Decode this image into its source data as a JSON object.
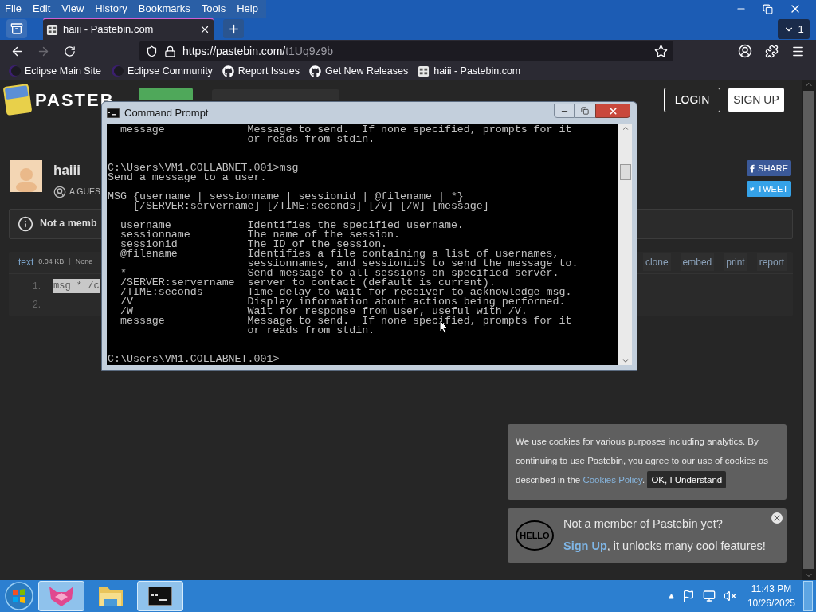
{
  "browser": {
    "menu": [
      "File",
      "Edit",
      "View",
      "History",
      "Bookmarks",
      "Tools",
      "Help"
    ],
    "tab": {
      "title": "haiii - Pastebin.com",
      "selected": true
    },
    "tab_count": "1",
    "forward_disabled": true,
    "url": {
      "host": "https://pastebin.com/",
      "path": "t1Uq9z9b"
    },
    "bookmarks": [
      {
        "label": "Eclipse Main Site",
        "kind": "eclipse"
      },
      {
        "label": "Eclipse Community",
        "kind": "eclipse"
      },
      {
        "label": "Report Issues",
        "kind": "github"
      },
      {
        "label": "Get New Releases",
        "kind": "github"
      },
      {
        "label": "haiii - Pastebin.com",
        "kind": "pastebin"
      }
    ]
  },
  "pastebin": {
    "logo_text": "PASTEB",
    "login": "LOGIN",
    "signup": "SIGN UP",
    "user": "haiii",
    "guest": "A GUES",
    "share": "SHARE",
    "tweet": "TWEET",
    "notice": "Not a memb",
    "toolbar": {
      "syntax": "text",
      "size": "0.04 KB",
      "separator": "|",
      "visibility": "None"
    },
    "actions": [
      "clone",
      "embed",
      "print",
      "report"
    ],
    "lines": [
      {
        "number": "1.",
        "code": "msg * /c",
        "highlighted": true
      },
      {
        "number": "2."
      }
    ]
  },
  "cookie_notice": {
    "text": "We use cookies for various purposes including analytics. By continuing to use Pastebin, you agree to our use of cookies as described in the ",
    "link": "Cookies Policy",
    "after": ".",
    "button": "OK, I Understand"
  },
  "signup_prompt": {
    "badge": "HELLO",
    "title": "Not a member of Pastebin yet?",
    "link": "Sign Up",
    "text": ", it unlocks many cool features!"
  },
  "cmd": {
    "title": "Command Prompt",
    "lines": [
      {
        "kind": "text",
        "text": "  message             Message to send.  If none specified, prompts for it"
      },
      {
        "kind": "text",
        "text": "                      or reads from stdin."
      },
      {
        "kind": "blank"
      },
      {
        "kind": "blank"
      },
      {
        "kind": "text",
        "text": "C:\\Users\\VM1.COLLABNET.001>msg"
      },
      {
        "kind": "text",
        "text": "Send a message to a user."
      },
      {
        "kind": "blank"
      },
      {
        "kind": "text",
        "text": "MSG {username | sessionname | sessionid | @filename | *}"
      },
      {
        "kind": "text",
        "text": "    [/SERVER:servername] [/TIME:seconds] [/V] [/W] [message]"
      },
      {
        "kind": "blank"
      },
      {
        "kind": "text",
        "text": "  username            Identifies the specified username."
      },
      {
        "kind": "text",
        "text": "  sessionname         The name of the session."
      },
      {
        "kind": "text",
        "text": "  sessionid           The ID of the session."
      },
      {
        "kind": "text",
        "text": "  @filename           Identifies a file containing a list of usernames,"
      },
      {
        "kind": "text",
        "text": "                      sessionnames, and sessionids to send the message to."
      },
      {
        "kind": "text",
        "text": "  *                   Send message to all sessions on specified server."
      },
      {
        "kind": "text",
        "text": "  /SERVER:servername  server to contact (default is current)."
      },
      {
        "kind": "text",
        "text": "  /TIME:seconds       Time delay to wait for receiver to acknowledge msg."
      },
      {
        "kind": "text",
        "text": "  /V                  Display information about actions being performed."
      },
      {
        "kind": "text",
        "text": "  /W                  Wait for response from user, useful with /V."
      },
      {
        "kind": "text",
        "text": "  message             Message to send.  If none specified, prompts for it"
      },
      {
        "kind": "text",
        "text": "                      or reads from stdin."
      },
      {
        "kind": "blank"
      },
      {
        "kind": "blank"
      },
      {
        "kind": "text",
        "text": "C:\\Users\\VM1.COLLABNET.001>"
      }
    ]
  },
  "taskbar": {
    "apps": [
      {
        "kind": "fox",
        "running": true
      },
      {
        "kind": "folder",
        "running": false
      },
      {
        "kind": "console",
        "running": true
      }
    ],
    "time": "11:43 PM",
    "date": "10/26/2025"
  }
}
